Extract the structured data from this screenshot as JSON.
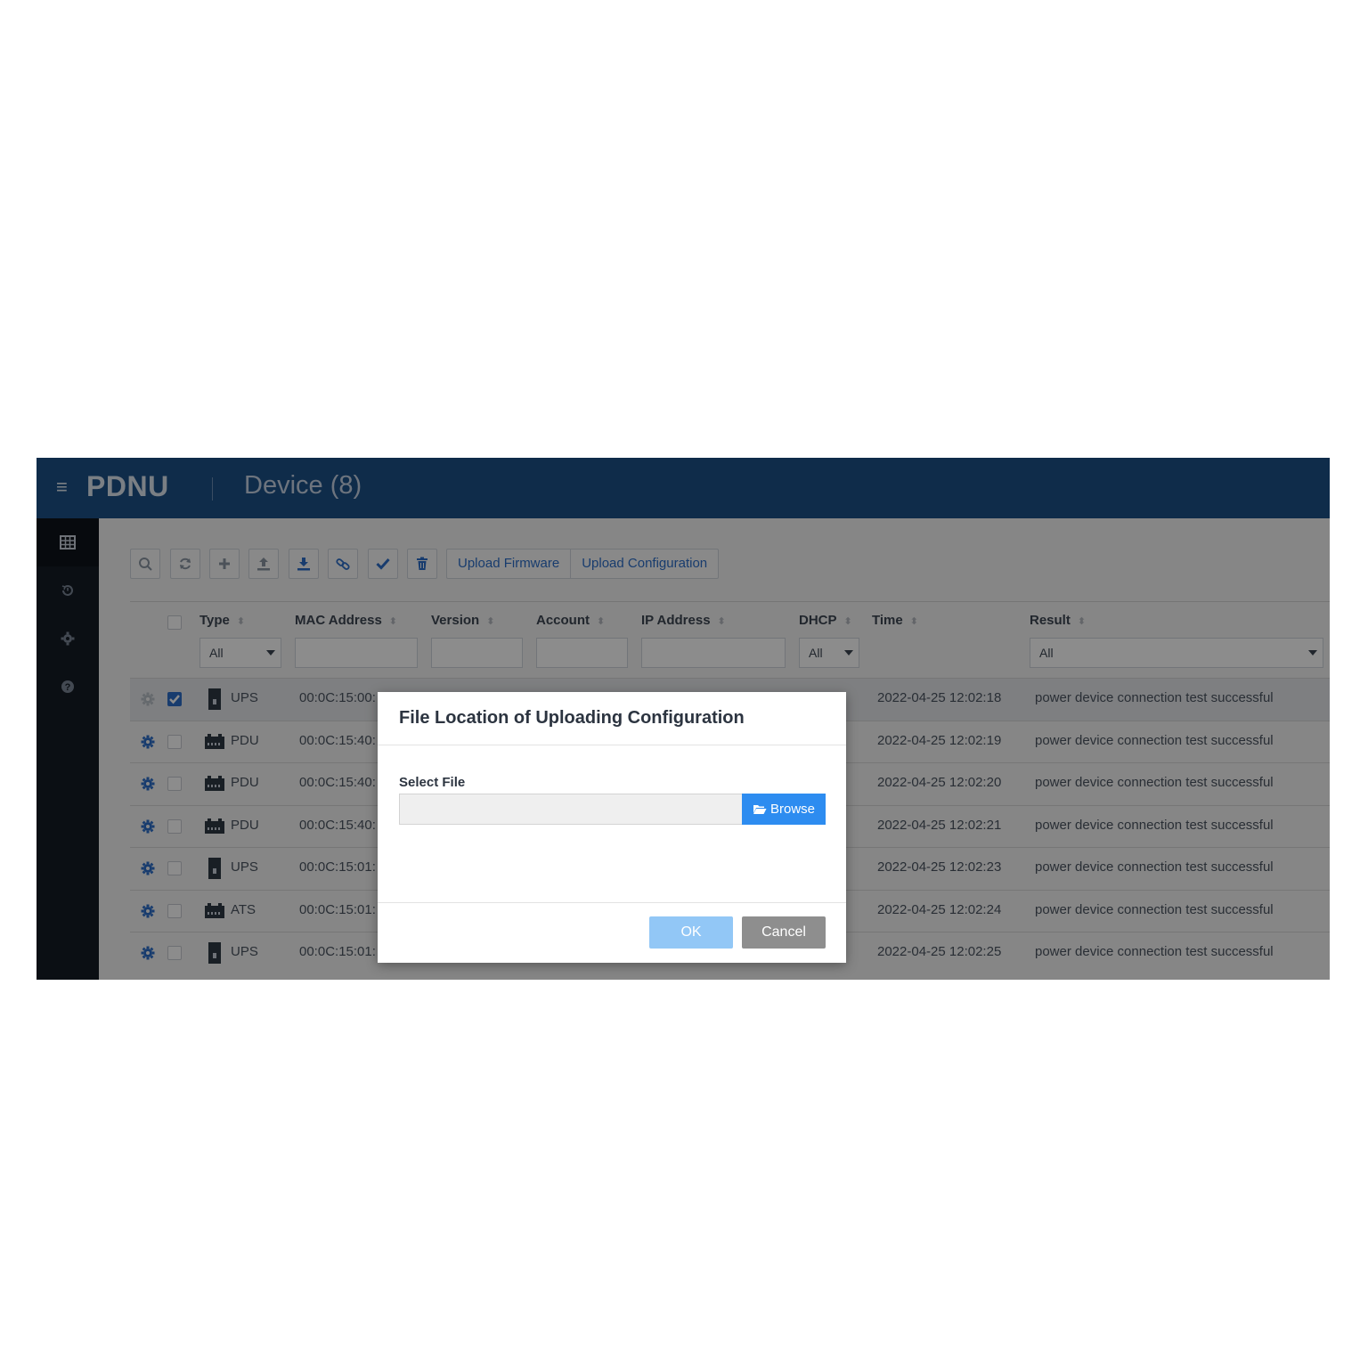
{
  "header": {
    "brand": "PDNU",
    "page_title": "Device (8)"
  },
  "sidebar": {
    "items": [
      {
        "icon": "table-icon",
        "active": true
      },
      {
        "icon": "history-icon",
        "active": false
      },
      {
        "icon": "gear-icon",
        "active": false
      },
      {
        "icon": "help-icon",
        "active": false
      }
    ]
  },
  "toolbar": {
    "icons": [
      "search-icon",
      "refresh-icon",
      "add-icon",
      "upload-icon",
      "download-icon",
      "link-icon",
      "check-icon",
      "trash-icon"
    ],
    "upload_firmware": "Upload Firmware",
    "upload_configuration": "Upload Configuration"
  },
  "table": {
    "headers": {
      "type": "Type",
      "mac": "MAC Address",
      "version": "Version",
      "account": "Account",
      "ip": "IP Address",
      "dhcp": "DHCP",
      "time": "Time",
      "result": "Result"
    },
    "filters": {
      "type": "All",
      "dhcp": "All",
      "result": "All"
    },
    "rows": [
      {
        "type": "UPS",
        "mac": "00:0C:15:00:",
        "time": "2022-04-25 12:02:18",
        "result": "power device connection test successful",
        "selected": true
      },
      {
        "type": "PDU",
        "mac": "00:0C:15:40:",
        "time": "2022-04-25 12:02:19",
        "result": "power device connection test successful",
        "selected": false
      },
      {
        "type": "PDU",
        "mac": "00:0C:15:40:",
        "time": "2022-04-25 12:02:20",
        "result": "power device connection test successful",
        "selected": false
      },
      {
        "type": "PDU",
        "mac": "00:0C:15:40:",
        "time": "2022-04-25 12:02:21",
        "result": "power device connection test successful",
        "selected": false
      },
      {
        "type": "UPS",
        "mac": "00:0C:15:01:",
        "time": "2022-04-25 12:02:23",
        "result": "power device connection test successful",
        "selected": false
      },
      {
        "type": "ATS",
        "mac": "00:0C:15:01:",
        "time": "2022-04-25 12:02:24",
        "result": "power device connection test successful",
        "selected": false
      },
      {
        "type": "UPS",
        "mac": "00:0C:15:01:",
        "time": "2022-04-25 12:02:25",
        "result": "power device connection test successful",
        "selected": false
      }
    ]
  },
  "modal": {
    "title": "File Location of Uploading Configuration",
    "select_label": "Select File",
    "file_value": "",
    "browse_label": "Browse",
    "ok_label": "OK",
    "cancel_label": "Cancel"
  },
  "colors": {
    "header_bg": "#1d5188",
    "accent": "#2d6ec8",
    "browse": "#2d8cf0",
    "ok_disabled": "#92c7f6",
    "cancel": "#8e8e8e"
  }
}
